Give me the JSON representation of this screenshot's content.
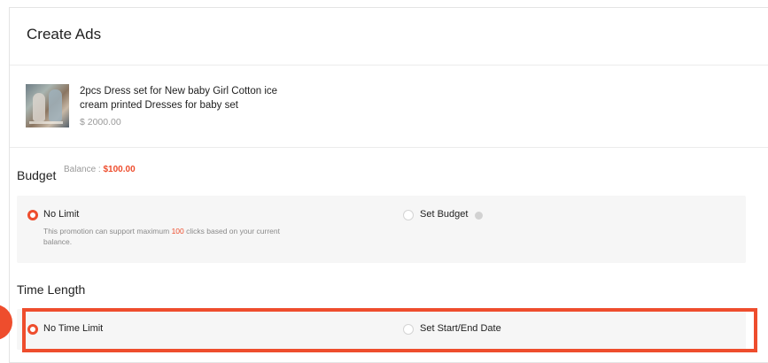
{
  "header": {
    "title": "Create Ads"
  },
  "product": {
    "name": "2pcs Dress set for New baby Girl Cotton ice cream printed Dresses for baby set",
    "price": "$ 2000.00"
  },
  "budget": {
    "title": "Budget",
    "balance_label": "Balance :",
    "balance_value": "$100.00",
    "options": [
      {
        "label": "No Limit",
        "selected": true,
        "description_prefix": "This promotion can support maximum",
        "description_highlight": "100",
        "description_suffix": "clicks based on your current balance."
      },
      {
        "label": "Set Budget",
        "selected": false,
        "icon": "help-icon"
      }
    ]
  },
  "time_length": {
    "title": "Time Length",
    "options": [
      {
        "label": "No Time Limit",
        "selected": true
      },
      {
        "label": "Set Start/End Date",
        "selected": false
      }
    ]
  },
  "colors": {
    "accent": "#ee4d2d",
    "text": "#222222",
    "muted": "#9a9a9a",
    "option_bg": "#f6f6f6"
  }
}
